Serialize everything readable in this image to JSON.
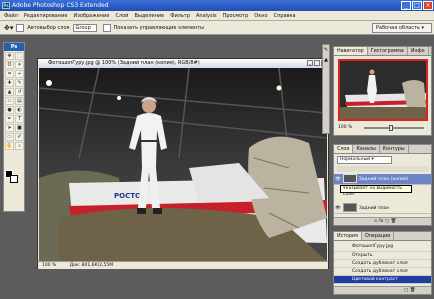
{
  "window": {
    "title": "Adobe Photoshop CS3 Extended"
  },
  "menu": [
    "Файл",
    "Редактирование",
    "Изображение",
    "Слой",
    "Выделение",
    "Фильтр",
    "Analysis",
    "Просмотр",
    "Окно",
    "Справка"
  ],
  "options": {
    "auto_select_label": "Автовыбор слоя",
    "auto_select_value": "Group",
    "show_controls_label": "Показать управляющие элементы",
    "workspace_label": "Рабочая область"
  },
  "toolbox": {
    "header": "Ps"
  },
  "document": {
    "title": "ФотошопГуру.jpg @ 100% (Задний план (копия), RGB/8#)",
    "zoom": "100 %",
    "doc_size": "Док: 801,6К/2,55М",
    "plane_text": "РОСТО"
  },
  "navigator": {
    "tabs": [
      "Навигатор",
      "Гистограмма",
      "Инфо"
    ],
    "zoom": "100 %"
  },
  "layers": {
    "tabs": [
      "Слои",
      "Каналы",
      "Контуры"
    ],
    "blend_mode": "Нормальный",
    "rows": [
      {
        "name": "Задний план (копия)"
      },
      {
        "name": "Задний план"
      }
    ],
    "tooltip": "Указывает на видимость слоя"
  },
  "history": {
    "tabs": [
      "История",
      "Операции"
    ],
    "snapshot": "ФотошопГуру.jpg",
    "items": [
      "Открыть",
      "Создать дубликат слоя",
      "Создать дубликат слоя",
      "Цветовой контраст"
    ],
    "selected_index": 3
  }
}
